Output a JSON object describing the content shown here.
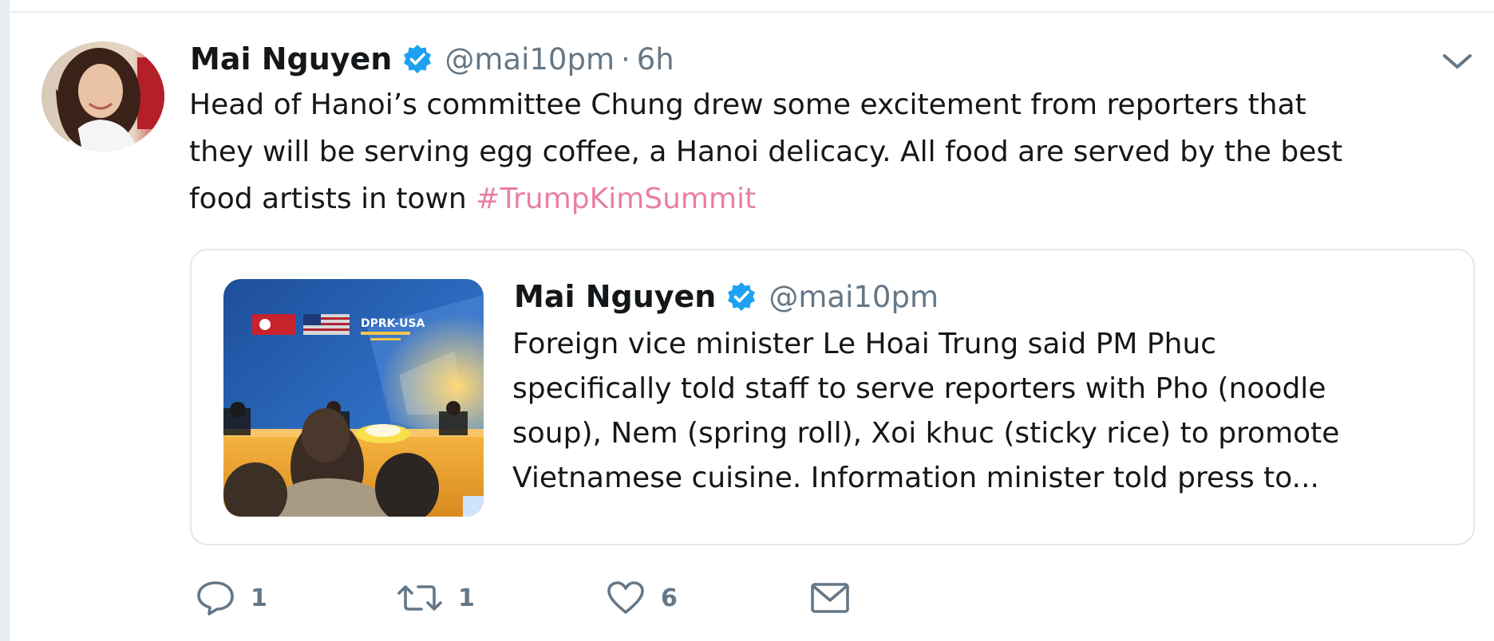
{
  "tweet": {
    "author_name": "Mai Nguyen",
    "handle": "@mai10pm",
    "separator": "·",
    "time": "6h",
    "text_lines": [
      "Head of Hanoi’s committee Chung drew some excitement from reporters that",
      "they will be serving egg coffee, a Hanoi delicacy. All food are served by the best",
      "food artists in town "
    ],
    "hashtag": "#TrumpKimSummit"
  },
  "quoted_tweet": {
    "author_name": "Mai Nguyen",
    "handle": "@mai10pm",
    "text_lines": [
      "Foreign vice minister Le Hoai Trung said PM Phuc",
      "specifically told staff to serve reporters with Pho (noodle",
      "soup), Nem (spring roll), Xoi khuc (sticky rice) to promote",
      "Vietnamese cuisine. Information minister told press to..."
    ],
    "image_banner_text": "DPRK-USA"
  },
  "actions": {
    "reply_count": "1",
    "retweet_count": "1",
    "like_count": "6"
  },
  "icons": {
    "verified": "verified-badge-icon",
    "caret": "chevron-down-icon",
    "reply": "reply-icon",
    "retweet": "retweet-icon",
    "like": "heart-icon",
    "message": "envelope-icon"
  },
  "colors": {
    "text": "#14171a",
    "secondary": "#657786",
    "hashtag": "#e87fa5",
    "verified": "#1da1f2",
    "border": "#e1e8ed"
  }
}
